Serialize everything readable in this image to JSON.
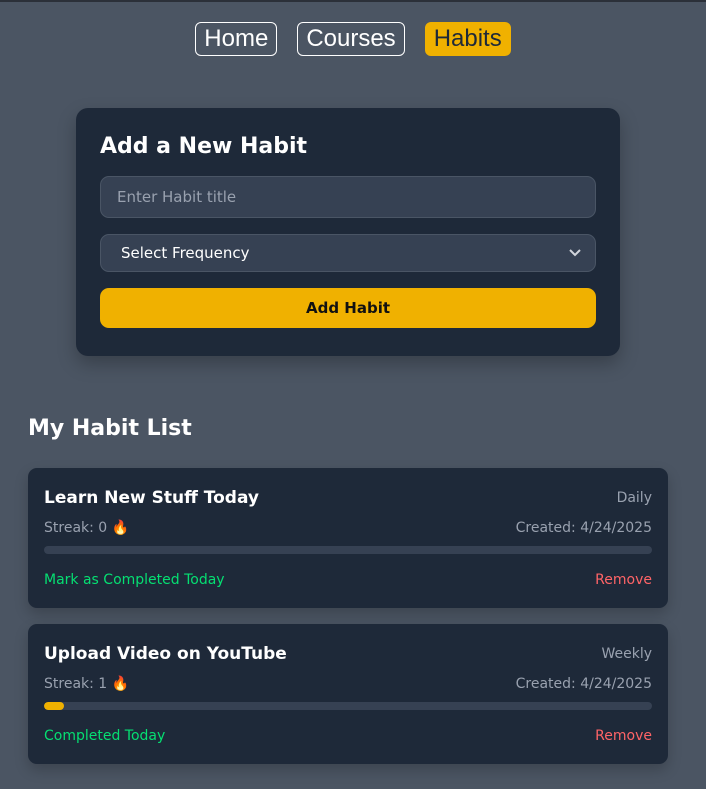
{
  "nav": {
    "items": [
      {
        "label": "Home",
        "active": false
      },
      {
        "label": "Courses",
        "active": false
      },
      {
        "label": "Habits",
        "active": true
      }
    ]
  },
  "form": {
    "title": "Add a New Habit",
    "title_placeholder": "Enter Habit title",
    "title_value": "",
    "frequency_selected": "Select Frequency",
    "submit_label": "Add Habit"
  },
  "list": {
    "title": "My Habit List",
    "habits": [
      {
        "title": "Learn New Stuff Today",
        "frequency": "Daily",
        "streak": "Streak: 0 🔥",
        "created": "Created: 4/24/2025",
        "progress": 0,
        "action": "Mark as Completed Today",
        "remove": "Remove"
      },
      {
        "title": "Upload Video on YouTube",
        "frequency": "Weekly",
        "streak": "Streak: 1 🔥",
        "created": "Created: 4/24/2025",
        "progress": 0.033,
        "action": "Completed Today",
        "remove": "Remove"
      }
    ]
  },
  "colors": {
    "background": "#4b5563",
    "card": "#1e2939",
    "accent": "#f0b100",
    "success": "#05df72",
    "danger": "#ff6467"
  }
}
